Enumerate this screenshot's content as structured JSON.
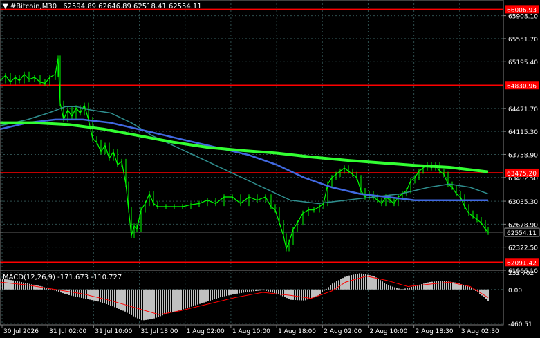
{
  "header": {
    "symbol": "#Bitcoin,M30",
    "ohlc": "62594.89 62646.89 62518.41 62554.11",
    "macd_label": "MACD(12,26,9) -171.673 -110.727"
  },
  "colors": {
    "background": "#000000",
    "grid": "#2f4f4f",
    "candles": "#00ff00",
    "ma_fast": "#2f8f8f",
    "ma_mid": "#4169e1",
    "ma_slow": "#32ff32",
    "level_line": "#ff0000",
    "macd_hist": "#c0c0c0",
    "macd_signal": "#ff0000",
    "axis_text": "#ffffff"
  },
  "chart_data": [
    {
      "type": "candlestick",
      "ylim": [
        61966.0,
        66150.0
      ],
      "y_ticks": [
        "65908.10",
        "65551.70",
        "65195.40",
        "64471.70",
        "64115.30",
        "63758.90",
        "63402.50",
        "63035.30",
        "62678.90",
        "62322.50",
        "61966.10"
      ],
      "y_tick_values": [
        65908.1,
        65551.7,
        65195.4,
        64471.7,
        64115.3,
        63758.9,
        63402.5,
        63035.3,
        62678.9,
        62322.5,
        61966.1
      ],
      "x_ticks": [
        "30 Jul 2026",
        "31 Jul 02:00",
        "31 Jul 10:00",
        "31 Jul 18:00",
        "1 Aug 02:00",
        "1 Aug 10:00",
        "1 Aug 18:00",
        "2 Aug 02:00",
        "2 Aug 10:00",
        "2 Aug 18:30",
        "3 Aug 02:30"
      ],
      "levels": [
        {
          "value": 66006.93,
          "label": "66006.93"
        },
        {
          "value": 64830.96,
          "label": "64830.96"
        },
        {
          "value": 63475.2,
          "label": "63475.20"
        },
        {
          "value": 62091.42,
          "label": "62091.42"
        }
      ],
      "current_price": {
        "value": 62554.11,
        "label": "62554.11"
      },
      "close_path": [
        [
          0,
          64900
        ],
        [
          8,
          64980
        ],
        [
          15,
          64880
        ],
        [
          22,
          64950
        ],
        [
          28,
          64900
        ],
        [
          35,
          65000
        ],
        [
          42,
          64920
        ],
        [
          50,
          64950
        ],
        [
          58,
          64880
        ],
        [
          65,
          64860
        ],
        [
          72,
          64950
        ],
        [
          80,
          65000
        ],
        [
          84,
          65250
        ],
        [
          87,
          64550
        ],
        [
          92,
          64300
        ],
        [
          98,
          64450
        ],
        [
          104,
          64350
        ],
        [
          110,
          64480
        ],
        [
          116,
          64400
        ],
        [
          122,
          64520
        ],
        [
          128,
          64300
        ],
        [
          134,
          64000
        ],
        [
          140,
          63950
        ],
        [
          146,
          63800
        ],
        [
          152,
          63900
        ],
        [
          158,
          63700
        ],
        [
          164,
          63800
        ],
        [
          170,
          63600
        ],
        [
          176,
          63650
        ],
        [
          182,
          63300
        ],
        [
          186,
          62900
        ],
        [
          190,
          62500
        ],
        [
          194,
          62650
        ],
        [
          198,
          62600
        ],
        [
          204,
          62900
        ],
        [
          210,
          63000
        ],
        [
          216,
          63150
        ],
        [
          222,
          63000
        ],
        [
          228,
          62950
        ],
        [
          240,
          62950
        ],
        [
          252,
          62950
        ],
        [
          264,
          62950
        ],
        [
          276,
          62980
        ],
        [
          288,
          63000
        ],
        [
          300,
          63050
        ],
        [
          312,
          63000
        ],
        [
          324,
          63100
        ],
        [
          336,
          63100
        ],
        [
          348,
          63000
        ],
        [
          360,
          63100
        ],
        [
          372,
          63050
        ],
        [
          384,
          63100
        ],
        [
          392,
          62950
        ],
        [
          398,
          62900
        ],
        [
          404,
          62700
        ],
        [
          410,
          62500
        ],
        [
          414,
          62300
        ],
        [
          418,
          62400
        ],
        [
          424,
          62600
        ],
        [
          430,
          62700
        ],
        [
          438,
          62850
        ],
        [
          446,
          62900
        ],
        [
          454,
          62900
        ],
        [
          462,
          62950
        ],
        [
          468,
          63000
        ],
        [
          474,
          63300
        ],
        [
          480,
          63400
        ],
        [
          486,
          63450
        ],
        [
          492,
          63500
        ],
        [
          498,
          63550
        ],
        [
          504,
          63500
        ],
        [
          510,
          63450
        ],
        [
          516,
          63400
        ],
        [
          522,
          63200
        ],
        [
          528,
          63100
        ],
        [
          534,
          63150
        ],
        [
          540,
          63100
        ],
        [
          546,
          63050
        ],
        [
          552,
          63000
        ],
        [
          558,
          63100
        ],
        [
          564,
          63050
        ],
        [
          570,
          63000
        ],
        [
          576,
          63100
        ],
        [
          582,
          63150
        ],
        [
          588,
          63200
        ],
        [
          594,
          63350
        ],
        [
          600,
          63400
        ],
        [
          606,
          63500
        ],
        [
          612,
          63550
        ],
        [
          618,
          63600
        ],
        [
          624,
          63550
        ],
        [
          630,
          63600
        ],
        [
          636,
          63500
        ],
        [
          642,
          63450
        ],
        [
          648,
          63300
        ],
        [
          654,
          63250
        ],
        [
          660,
          63150
        ],
        [
          666,
          63100
        ],
        [
          672,
          62950
        ],
        [
          678,
          62850
        ],
        [
          684,
          62800
        ],
        [
          690,
          62750
        ],
        [
          696,
          62700
        ],
        [
          702,
          62600
        ],
        [
          706,
          62554
        ]
      ],
      "ma_fast_path": [
        [
          0,
          64200
        ],
        [
          40,
          64300
        ],
        [
          70,
          64400
        ],
        [
          95,
          64500
        ],
        [
          110,
          64500
        ],
        [
          130,
          64450
        ],
        [
          160,
          64400
        ],
        [
          190,
          64250
        ],
        [
          220,
          64050
        ],
        [
          260,
          63850
        ],
        [
          300,
          63650
        ],
        [
          340,
          63450
        ],
        [
          380,
          63250
        ],
        [
          420,
          63050
        ],
        [
          460,
          63000
        ],
        [
          500,
          63050
        ],
        [
          540,
          63100
        ],
        [
          580,
          63150
        ],
        [
          620,
          63250
        ],
        [
          650,
          63300
        ],
        [
          680,
          63250
        ],
        [
          706,
          63150
        ]
      ],
      "ma_mid_path": [
        [
          0,
          64150
        ],
        [
          40,
          64250
        ],
        [
          80,
          64300
        ],
        [
          120,
          64300
        ],
        [
          160,
          64250
        ],
        [
          200,
          64150
        ],
        [
          240,
          64050
        ],
        [
          280,
          63950
        ],
        [
          320,
          63850
        ],
        [
          360,
          63750
        ],
        [
          400,
          63600
        ],
        [
          440,
          63400
        ],
        [
          480,
          63250
        ],
        [
          520,
          63150
        ],
        [
          560,
          63100
        ],
        [
          600,
          63050
        ],
        [
          640,
          63050
        ],
        [
          680,
          63050
        ],
        [
          706,
          63050
        ]
      ],
      "ma_slow_path": [
        [
          0,
          64250
        ],
        [
          50,
          64250
        ],
        [
          100,
          64220
        ],
        [
          150,
          64150
        ],
        [
          200,
          64050
        ],
        [
          250,
          63950
        ],
        [
          300,
          63870
        ],
        [
          350,
          63820
        ],
        [
          400,
          63780
        ],
        [
          450,
          63720
        ],
        [
          500,
          63670
        ],
        [
          550,
          63630
        ],
        [
          600,
          63590
        ],
        [
          650,
          63560
        ],
        [
          706,
          63490
        ]
      ]
    },
    {
      "type": "histogram",
      "ylim": [
        -480.0,
        260.0
      ],
      "y_ticks": [
        "232.702",
        "0.00",
        "-460.51"
      ],
      "y_tick_values": [
        232.702,
        0.0,
        -460.51
      ],
      "histogram_path": [
        [
          0,
          150
        ],
        [
          20,
          120
        ],
        [
          40,
          80
        ],
        [
          60,
          40
        ],
        [
          80,
          -20
        ],
        [
          100,
          -80
        ],
        [
          120,
          -120
        ],
        [
          140,
          -160
        ],
        [
          160,
          -220
        ],
        [
          180,
          -300
        ],
        [
          195,
          -380
        ],
        [
          205,
          -420
        ],
        [
          220,
          -400
        ],
        [
          240,
          -330
        ],
        [
          260,
          -280
        ],
        [
          280,
          -220
        ],
        [
          300,
          -160
        ],
        [
          320,
          -100
        ],
        [
          340,
          -60
        ],
        [
          360,
          -30
        ],
        [
          380,
          -10
        ],
        [
          400,
          -60
        ],
        [
          420,
          -140
        ],
        [
          440,
          -150
        ],
        [
          460,
          -80
        ],
        [
          480,
          80
        ],
        [
          500,
          180
        ],
        [
          520,
          220
        ],
        [
          540,
          180
        ],
        [
          560,
          60
        ],
        [
          580,
          0
        ],
        [
          600,
          50
        ],
        [
          620,
          100
        ],
        [
          640,
          120
        ],
        [
          660,
          90
        ],
        [
          680,
          30
        ],
        [
          700,
          -110
        ],
        [
          706,
          -171
        ]
      ],
      "signal_path": [
        [
          0,
          100
        ],
        [
          40,
          60
        ],
        [
          80,
          0
        ],
        [
          120,
          -60
        ],
        [
          160,
          -150
        ],
        [
          200,
          -260
        ],
        [
          230,
          -340
        ],
        [
          260,
          -290
        ],
        [
          300,
          -200
        ],
        [
          340,
          -110
        ],
        [
          380,
          -40
        ],
        [
          420,
          -80
        ],
        [
          450,
          -120
        ],
        [
          480,
          -20
        ],
        [
          500,
          100
        ],
        [
          530,
          180
        ],
        [
          560,
          120
        ],
        [
          590,
          40
        ],
        [
          620,
          70
        ],
        [
          650,
          100
        ],
        [
          680,
          40
        ],
        [
          706,
          -110
        ]
      ]
    }
  ]
}
